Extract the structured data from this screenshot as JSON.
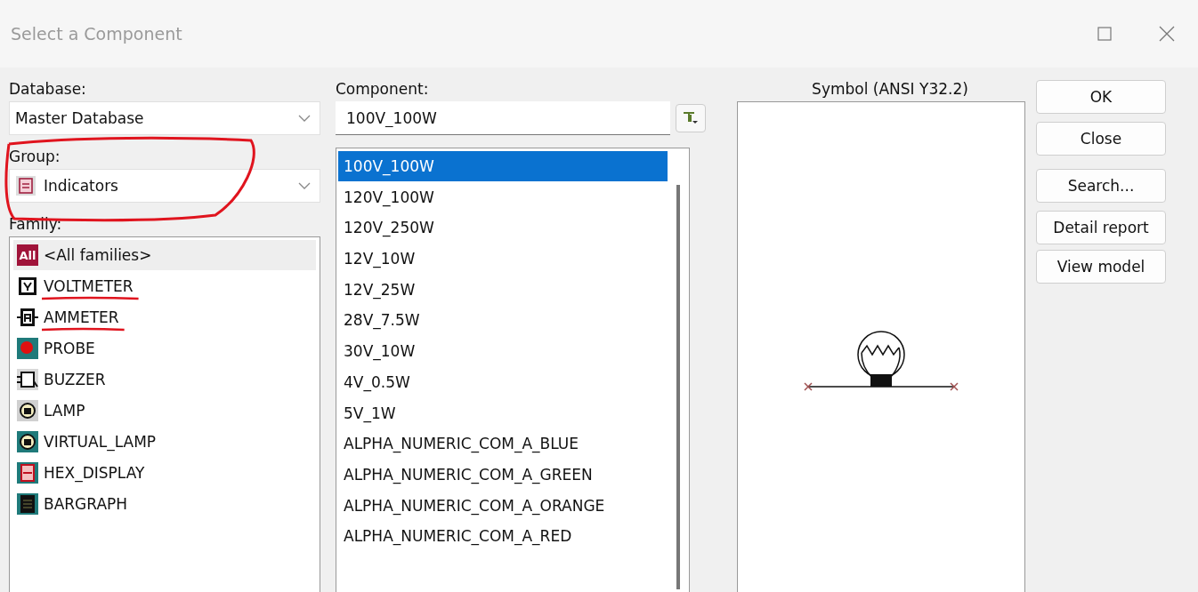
{
  "window": {
    "title": "Select a Component"
  },
  "database": {
    "label": "Database:",
    "value": "Master Database"
  },
  "group": {
    "label": "Group:",
    "value": "Indicators",
    "circled": true
  },
  "family": {
    "label": "Family:",
    "items": [
      {
        "kind": "all",
        "badge": "All",
        "label": "<All families>",
        "selected": true,
        "underlined": false
      },
      {
        "kind": "voltmeter",
        "label": "VOLTMETER",
        "selected": false,
        "underlined": true
      },
      {
        "kind": "ammeter",
        "label": "AMMETER",
        "selected": false,
        "underlined": true
      },
      {
        "kind": "probe",
        "label": "PROBE",
        "selected": false,
        "underlined": false
      },
      {
        "kind": "buzzer",
        "label": "BUZZER",
        "selected": false,
        "underlined": false
      },
      {
        "kind": "lamp",
        "label": "LAMP",
        "selected": false,
        "underlined": false
      },
      {
        "kind": "virtual_lamp",
        "label": "VIRTUAL_LAMP",
        "selected": false,
        "underlined": false
      },
      {
        "kind": "hex",
        "label": "HEX_DISPLAY",
        "selected": false,
        "underlined": false
      },
      {
        "kind": "bargraph",
        "label": "BARGRAPH",
        "selected": false,
        "underlined": false
      }
    ]
  },
  "component": {
    "label": "Component:",
    "value": "100V_100W",
    "items": [
      {
        "label": "100V_100W",
        "selected": true
      },
      {
        "label": "120V_100W",
        "selected": false
      },
      {
        "label": "120V_250W",
        "selected": false
      },
      {
        "label": "12V_10W",
        "selected": false
      },
      {
        "label": "12V_25W",
        "selected": false
      },
      {
        "label": "28V_7.5W",
        "selected": false
      },
      {
        "label": "30V_10W",
        "selected": false
      },
      {
        "label": "4V_0.5W",
        "selected": false
      },
      {
        "label": "5V_1W",
        "selected": false
      },
      {
        "label": "ALPHA_NUMERIC_COM_A_BLUE",
        "selected": false
      },
      {
        "label": "ALPHA_NUMERIC_COM_A_GREEN",
        "selected": false
      },
      {
        "label": "ALPHA_NUMERIC_COM_A_ORANGE",
        "selected": false
      },
      {
        "label": "ALPHA_NUMERIC_COM_A_RED",
        "selected": false
      }
    ]
  },
  "symbol": {
    "label": "Symbol (ANSI Y32.2)"
  },
  "buttons": [
    "OK",
    "Close",
    "Search...",
    "Detail report",
    "View model"
  ]
}
